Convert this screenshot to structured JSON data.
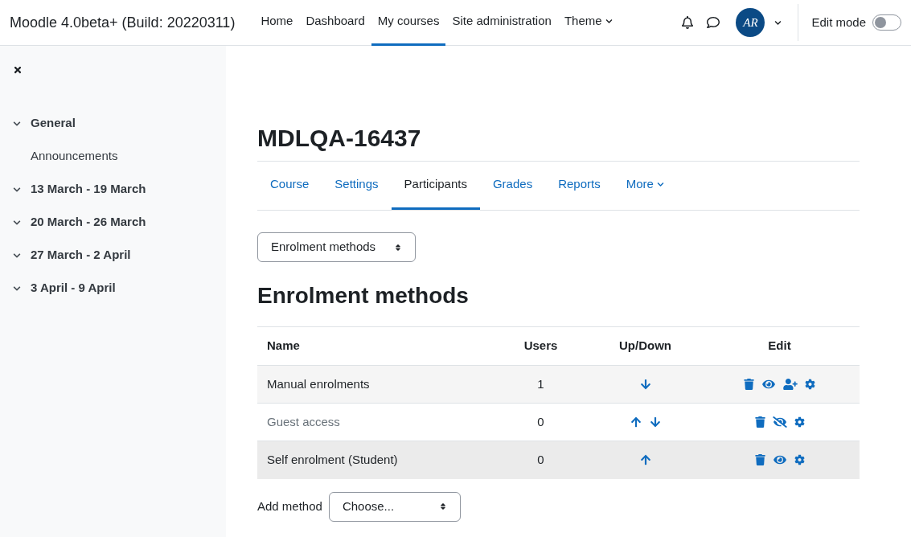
{
  "navbar": {
    "site_name": "Moodle 4.0beta+ (Build: 20220311)",
    "links": [
      {
        "label": "Home",
        "selected": false,
        "kind": "link"
      },
      {
        "label": "Dashboard",
        "selected": false,
        "kind": "link"
      },
      {
        "label": "My courses",
        "selected": true,
        "kind": "link"
      },
      {
        "label": "Site administration",
        "selected": false,
        "kind": "link"
      },
      {
        "label": "Theme",
        "selected": false,
        "kind": "menu"
      }
    ],
    "avatar_initials": "AR",
    "edit_mode": {
      "label": "Edit mode",
      "on": false
    }
  },
  "sidebar": {
    "sections": [
      {
        "label": "General",
        "expanded": true,
        "children": [
          {
            "label": "Announcements"
          }
        ]
      },
      {
        "label": "13 March - 19 March",
        "expanded": true
      },
      {
        "label": "20 March - 26 March",
        "expanded": true
      },
      {
        "label": "27 March - 2 April",
        "expanded": true
      },
      {
        "label": "3 April - 9 April",
        "expanded": true
      }
    ]
  },
  "course_title": "MDLQA-16437",
  "tabs": [
    {
      "label": "Course",
      "selected": false,
      "kind": "link"
    },
    {
      "label": "Settings",
      "selected": false,
      "kind": "link"
    },
    {
      "label": "Participants",
      "selected": true,
      "kind": "link"
    },
    {
      "label": "Grades",
      "selected": false,
      "kind": "link"
    },
    {
      "label": "Reports",
      "selected": false,
      "kind": "link"
    },
    {
      "label": "More",
      "selected": false,
      "kind": "menu"
    }
  ],
  "page_select": {
    "value": "Enrolment methods"
  },
  "heading": "Enrolment methods",
  "table": {
    "columns": [
      "Name",
      "Users",
      "Up/Down",
      "Edit"
    ],
    "rows": [
      {
        "name": "Manual enrolments",
        "users": "1",
        "enabled": true,
        "hovered": false,
        "can_move_up": false,
        "can_move_down": true,
        "actions": [
          {
            "kind": "delete"
          },
          {
            "kind": "hide"
          },
          {
            "kind": "enrol"
          },
          {
            "kind": "settings"
          }
        ]
      },
      {
        "name": "Guest access",
        "users": "0",
        "enabled": false,
        "hovered": false,
        "can_move_up": true,
        "can_move_down": true,
        "actions": [
          {
            "kind": "delete"
          },
          {
            "kind": "show"
          },
          {
            "kind": "settings"
          }
        ]
      },
      {
        "name": "Self enrolment (Student)",
        "users": "0",
        "enabled": true,
        "hovered": true,
        "can_move_up": true,
        "can_move_down": false,
        "actions": [
          {
            "kind": "delete"
          },
          {
            "kind": "hide"
          },
          {
            "kind": "settings"
          }
        ]
      }
    ]
  },
  "add_method": {
    "label": "Add method",
    "value": "Choose..."
  }
}
